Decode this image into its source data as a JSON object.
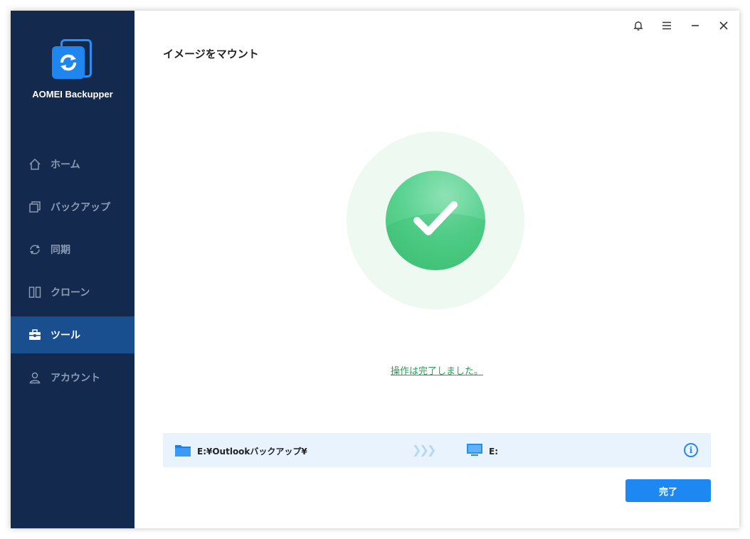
{
  "app": {
    "name": "AOMEI Backupper"
  },
  "sidebar": {
    "items": [
      {
        "label": "ホーム",
        "icon": "home-icon",
        "active": false
      },
      {
        "label": "バックアップ",
        "icon": "backup-icon",
        "active": false
      },
      {
        "label": "同期",
        "icon": "sync-icon",
        "active": false
      },
      {
        "label": "クローン",
        "icon": "clone-icon",
        "active": false
      },
      {
        "label": "ツール",
        "icon": "toolbox-icon",
        "active": true
      },
      {
        "label": "アカウント",
        "icon": "user-icon",
        "active": false
      }
    ]
  },
  "titlebar": {
    "icons": [
      "bell-icon",
      "menu-icon",
      "minimize-icon",
      "close-icon"
    ]
  },
  "page": {
    "title": "イメージをマウント",
    "status_message": "操作は完了しました。"
  },
  "mount": {
    "source_path": "E:¥Outlookバックアップ¥",
    "destination": "E:",
    "arrows": "❯❯❯"
  },
  "actions": {
    "finish_label": "完了"
  },
  "colors": {
    "sidebar_bg": "#13294e",
    "sidebar_active": "#1a4f8f",
    "accent": "#1e88f2",
    "success": "#3fc173",
    "path_bar_bg": "#e9f3fd"
  }
}
